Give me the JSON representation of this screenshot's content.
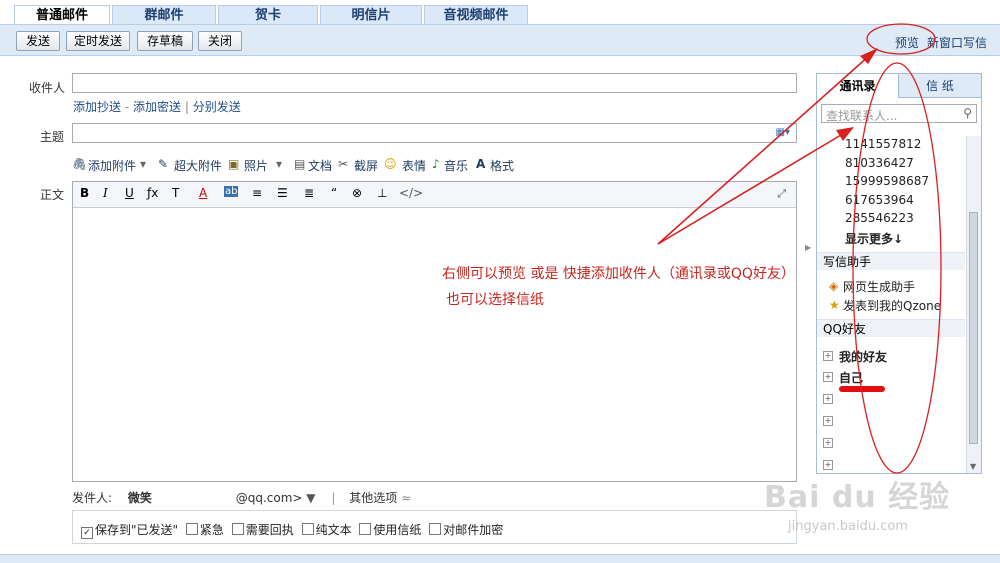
{
  "tabs": [
    "普通邮件",
    "群邮件",
    "贺卡",
    "明信片",
    "音视频邮件"
  ],
  "toolbar": {
    "send": "发送",
    "timed_send": "定时发送",
    "save_draft": "存草稿",
    "close": "关闭",
    "preview": "预览",
    "new_window": "新窗口写信"
  },
  "form": {
    "to_label": "收件人",
    "add_cc": "添加抄送",
    "add_bcc": "添加密送",
    "separate_send": "分别发送",
    "subject_label": "主题",
    "body_label": "正文",
    "attach": "添加附件",
    "big_attach": "超大附件",
    "photo": "照片",
    "doc": "文档",
    "screenshot": "截屏",
    "emoji": "表情",
    "music": "音乐",
    "format": "格式"
  },
  "editor_tools": [
    "B",
    "I",
    "U",
    "ƒx",
    "T",
    "A",
    "ab",
    "≡",
    "☰",
    "≣",
    "“",
    "⊗",
    "⊥",
    "</>"
  ],
  "sidebar": {
    "tab_contacts": "通讯录",
    "tab_stationery": "信 纸",
    "search_placeholder": "查找联系人...",
    "contacts": [
      "1141557812",
      "810336427",
      "15999598687",
      "617653964",
      "285546223"
    ],
    "show_more": "显示更多↓",
    "helper_title": "写信助手",
    "helper_items": [
      "网页生成助手",
      "发表到我的Qzone"
    ],
    "qq_title": "QQ好友",
    "qq_groups": [
      "我的好友",
      "自己"
    ]
  },
  "annotation": {
    "line1": "右侧可以预览 或是 快捷添加收件人（通讯录或QQ好友）",
    "line2": "也可以选择信纸"
  },
  "footer": {
    "sender_label": "发件人:",
    "sender_name": "微笑",
    "sender_email": "@qq.com>",
    "other_options": "其他选项",
    "options": [
      "保存到\"已发送\"",
      "紧急",
      "需要回执",
      "纯文本",
      "使用信纸",
      "对邮件加密"
    ]
  },
  "watermark": {
    "brand": "Bai du 经验",
    "url": "jingyan.baidu.com"
  }
}
